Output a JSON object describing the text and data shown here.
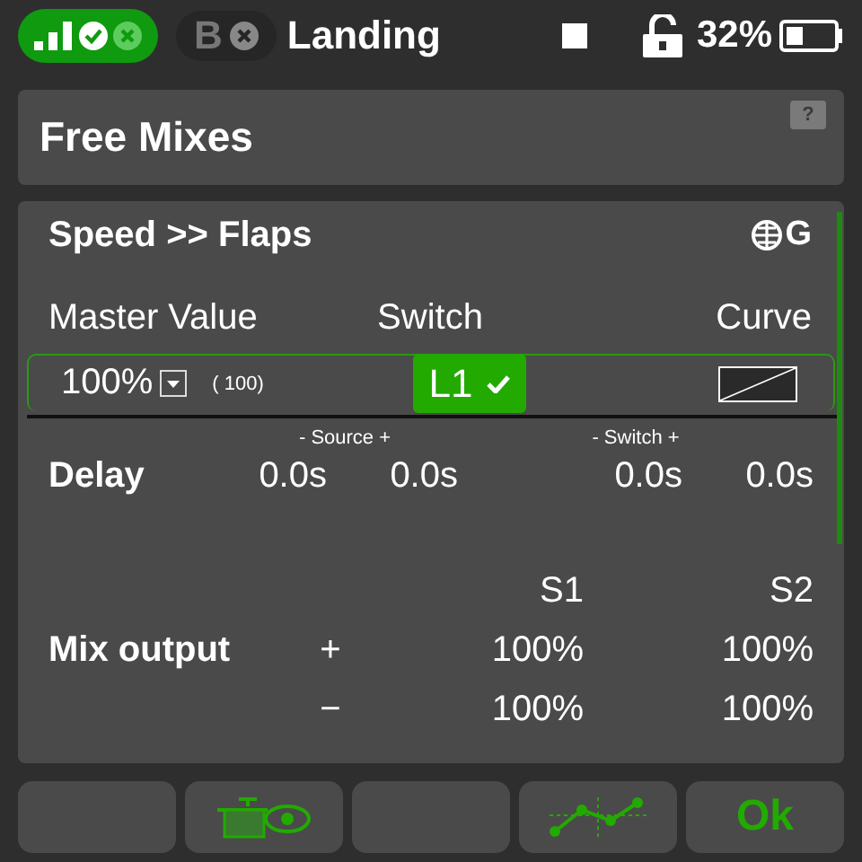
{
  "status_bar": {
    "badge_letter": "B",
    "model_name": "Landing",
    "battery": "32%"
  },
  "page": {
    "title": "Free Mixes",
    "help": "?"
  },
  "mix": {
    "title": "Speed >> Flaps",
    "scope": "G",
    "headers": [
      "Master Value",
      "Switch",
      "Curve"
    ],
    "master_value": "100%",
    "raw_value": "( 100)",
    "switch": {
      "label": "L1",
      "active": true
    },
    "delay": {
      "label": "Delay",
      "source_caption": "- Source +",
      "switch_caption": "- Switch +",
      "values": [
        "0.0s",
        "0.0s",
        "0.0s",
        "0.0s"
      ]
    },
    "output": {
      "label": "Mix output",
      "columns": [
        "S1",
        "S2"
      ],
      "rows": [
        {
          "sign": "+",
          "values": [
            "100%",
            "100%"
          ]
        },
        {
          "sign": "−",
          "values": [
            "100%",
            "100%"
          ]
        }
      ]
    }
  },
  "buttons": [
    {
      "kind": "blank"
    },
    {
      "kind": "preview"
    },
    {
      "kind": "blank"
    },
    {
      "kind": "curve"
    },
    {
      "kind": "text",
      "label": "Ok"
    }
  ]
}
